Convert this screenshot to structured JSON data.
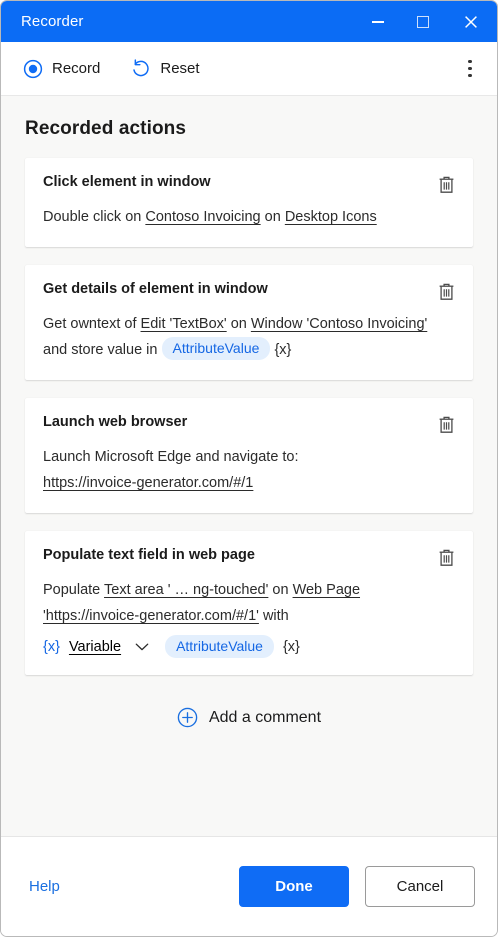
{
  "window": {
    "title": "Recorder",
    "controls": {
      "minimize": "minimize",
      "maximize": "maximize",
      "close": "close"
    },
    "accent_color": "#0b6cf5",
    "content_bg": "#f8f8f7"
  },
  "toolbar": {
    "record_label": "Record",
    "reset_label": "Reset",
    "overflow_label": "More options"
  },
  "main": {
    "section_title": "Recorded actions",
    "cards": [
      {
        "title": "Click element in window",
        "line1_pre": "Double click on",
        "link1": "Contoso Invoicing",
        "mid1": "on",
        "link2": "Desktop Icons",
        "delete_label": "Delete"
      },
      {
        "title": "Get details of element in window",
        "line1_pre": "Get owntext of",
        "link1": "Edit 'TextBox'",
        "mid1": "on",
        "link2": "Window 'Contoso Invoicing'",
        "line2_pre": "and store value in",
        "pill": "AttributeValue",
        "xtoken": "{x}",
        "delete_label": "Delete"
      },
      {
        "title": "Launch web browser",
        "line1": "Launch Microsoft Edge and navigate to:",
        "link1": "https://invoice-generator.com/#/1",
        "delete_label": "Delete"
      },
      {
        "title": "Populate text field in web page",
        "line1_pre": "Populate",
        "link1": "Text area ' …  ng-touched'",
        "mid1": "on",
        "link2": "Web Page 'https://invoice-generator.com/#/1'",
        "mid2": "with",
        "x_blue": "{x}",
        "variable_label": "Variable",
        "pill": "AttributeValue",
        "xtoken": "{x}",
        "delete_label": "Delete"
      }
    ],
    "add_comment_label": "Add a comment"
  },
  "footer": {
    "help_label": "Help",
    "done_label": "Done",
    "cancel_label": "Cancel"
  }
}
